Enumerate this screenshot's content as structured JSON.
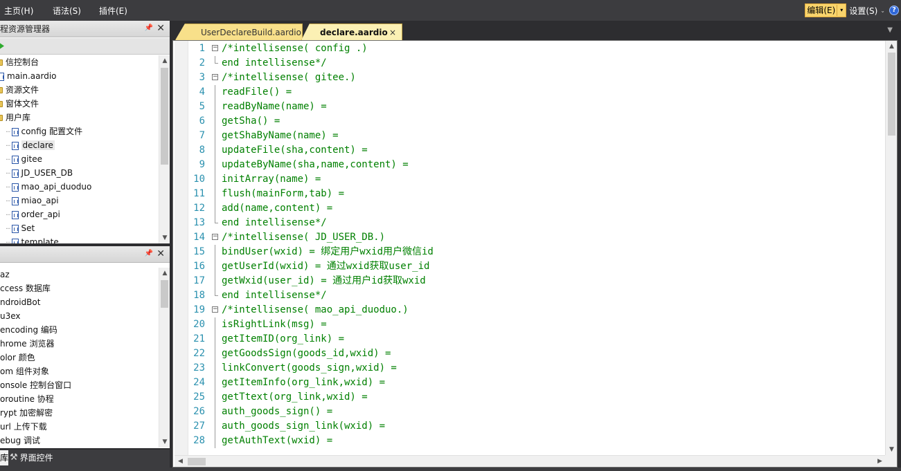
{
  "menubar": {
    "home": "主页(H)",
    "syntax": "语法(S)",
    "plugins": "插件(E)",
    "edit": "编辑(E)",
    "settings": "设置(S)",
    "help": "?"
  },
  "project_panel": {
    "title": "程资源管理器",
    "items": [
      {
        "label": "信控制台",
        "type": "folder"
      },
      {
        "label": "main.aardio",
        "type": "file"
      },
      {
        "label": "资源文件",
        "type": "folder"
      },
      {
        "label": "窗体文件",
        "type": "folder"
      },
      {
        "label": "用户库",
        "type": "folder"
      },
      {
        "label": "config 配置文件",
        "type": "lib"
      },
      {
        "label": "declare",
        "type": "lib"
      },
      {
        "label": "gitee",
        "type": "lib"
      },
      {
        "label": "JD_USER_DB",
        "type": "lib"
      },
      {
        "label": "mao_api_duoduo",
        "type": "lib"
      },
      {
        "label": "miao_api",
        "type": "lib"
      },
      {
        "label": "order_api",
        "type": "lib"
      },
      {
        "label": "Set",
        "type": "lib"
      },
      {
        "label": "template",
        "type": "lib"
      }
    ]
  },
  "library_panel": {
    "title": "",
    "items": [
      "az",
      "ccess 数据库",
      "ndroidBot",
      "u3ex",
      "encoding 编码",
      "hrome 浏览器",
      "olor 颜色",
      "om 组件对象",
      "onsole 控制台窗口",
      "oroutine 协程",
      "rypt 加密解密",
      "url 上传下载",
      "ebug 调试"
    ]
  },
  "left_tabs": {
    "tab_a": "库",
    "tab_b": "界面控件"
  },
  "editor": {
    "tabs": [
      {
        "label": "UserDeclareBuild.aardio",
        "active": false
      },
      {
        "label": "declare.aardio",
        "active": true
      }
    ],
    "tab_close": "×",
    "lines": [
      {
        "n": "1",
        "text": "/*intellisense( config .)",
        "fold": "start"
      },
      {
        "n": "2",
        "text": "end intellisense*/",
        "fold": "end"
      },
      {
        "n": "3",
        "text": "/*intellisense( gitee.)",
        "fold": "start"
      },
      {
        "n": "4",
        "text": "readFile() =",
        "fold": "line"
      },
      {
        "n": "5",
        "text": "readByName(name) =",
        "fold": "line"
      },
      {
        "n": "6",
        "text": "getSha() =",
        "fold": "line"
      },
      {
        "n": "7",
        "text": "getShaByName(name) =",
        "fold": "line"
      },
      {
        "n": "8",
        "text": "updateFile(sha,content) =",
        "fold": "line"
      },
      {
        "n": "9",
        "text": "updateByName(sha,name,content) =",
        "fold": "line"
      },
      {
        "n": "10",
        "text": "initArray(name) =",
        "fold": "line"
      },
      {
        "n": "11",
        "text": "flush(mainForm,tab) =",
        "fold": "line"
      },
      {
        "n": "12",
        "text": "add(name,content) =",
        "fold": "line"
      },
      {
        "n": "13",
        "text": "end intellisense*/",
        "fold": "end"
      },
      {
        "n": "14",
        "text": "/*intellisense( JD_USER_DB.)",
        "fold": "start"
      },
      {
        "n": "15",
        "text": "bindUser(wxid) = 绑定用户wxid用户微信id",
        "fold": "line"
      },
      {
        "n": "16",
        "text": "getUserId(wxid) = 通过wxid获取user_id",
        "fold": "line"
      },
      {
        "n": "17",
        "text": "getWxid(user_id) = 通过用户id获取wxid",
        "fold": "line"
      },
      {
        "n": "18",
        "text": "end intellisense*/",
        "fold": "end"
      },
      {
        "n": "19",
        "text": "/*intellisense( mao_api_duoduo.)",
        "fold": "start"
      },
      {
        "n": "20",
        "text": "isRightLink(msg) =",
        "fold": "line"
      },
      {
        "n": "21",
        "text": "getItemID(org_link) =",
        "fold": "line"
      },
      {
        "n": "22",
        "text": "getGoodsSign(goods_id,wxid) =",
        "fold": "line"
      },
      {
        "n": "23",
        "text": "linkConvert(goods_sign,wxid) =",
        "fold": "line"
      },
      {
        "n": "24",
        "text": "getItemInfo(org_link,wxid) =",
        "fold": "line"
      },
      {
        "n": "25",
        "text": "getTtext(org_link,wxid) =",
        "fold": "line"
      },
      {
        "n": "26",
        "text": "auth_goods_sign() =",
        "fold": "line"
      },
      {
        "n": "27",
        "text": "auth_goods_sign_link(wxid) =",
        "fold": "line"
      },
      {
        "n": "28",
        "text": "getAuthText(wxid) =",
        "fold": "line"
      }
    ]
  },
  "colors": {
    "code_green": "#008000",
    "line_number_blue": "#2b91af",
    "active_tab": "#fbf0b4",
    "inactive_tab": "#f8e08a",
    "chrome_dark": "#3c3c3f"
  }
}
